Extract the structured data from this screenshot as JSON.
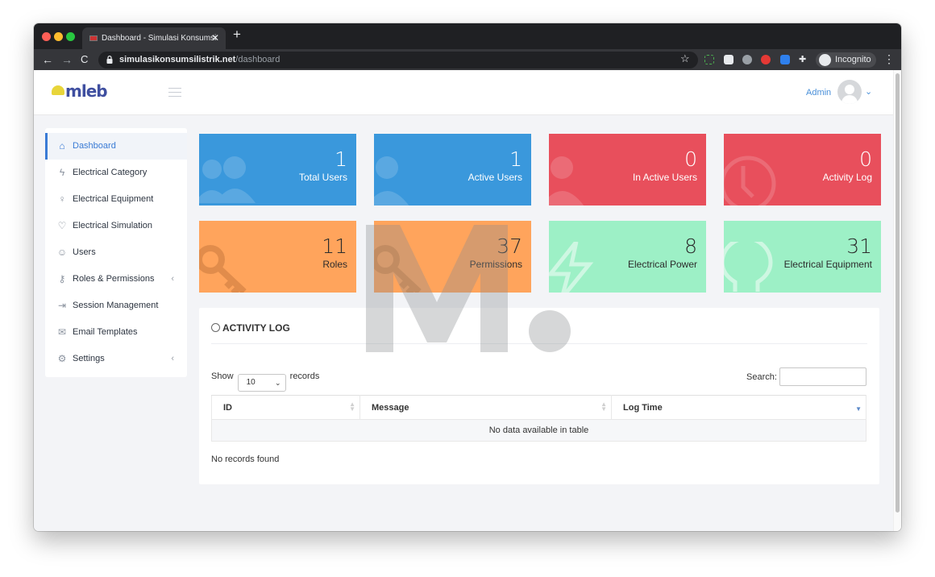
{
  "browser": {
    "tab_title": "Dashboard - Simulasi Konsumsi",
    "url_host": "simulasikonsumsilistrik.net",
    "url_path": "/dashboard",
    "incognito_label": "Incognito"
  },
  "header": {
    "logo_text": "mleb",
    "user_name": "Admin"
  },
  "sidebar": {
    "items": [
      {
        "label": "Dashboard",
        "icon": "home-icon",
        "active": true
      },
      {
        "label": "Electrical Category",
        "icon": "bolt-icon"
      },
      {
        "label": "Electrical Equipment",
        "icon": "lightbulb-icon"
      },
      {
        "label": "Electrical Simulation",
        "icon": "plug-icon"
      },
      {
        "label": "Users",
        "icon": "user-icon"
      },
      {
        "label": "Roles & Permissions",
        "icon": "key-icon",
        "has_submenu": true
      },
      {
        "label": "Session Management",
        "icon": "sign-in-icon"
      },
      {
        "label": "Email Templates",
        "icon": "envelope-icon"
      },
      {
        "label": "Settings",
        "icon": "gear-icon",
        "has_submenu": true
      }
    ]
  },
  "cards": [
    {
      "value": "1",
      "label": "Total Users",
      "color": "#3a98dc",
      "icon": "users-icon"
    },
    {
      "value": "1",
      "label": "Active Users",
      "color": "#3a98dc",
      "icon": "user-icon"
    },
    {
      "value": "0",
      "label": "In Active Users",
      "color": "#e84f5c",
      "icon": "user-icon"
    },
    {
      "value": "0",
      "label": "Activity Log",
      "color": "#e84f5c",
      "icon": "clock-icon"
    },
    {
      "value": "11",
      "label": "Roles",
      "color": "#ffa45c",
      "icon": "key-icon"
    },
    {
      "value": "37",
      "label": "Permissions",
      "color": "#ffa45c",
      "icon": "key-icon"
    },
    {
      "value": "8",
      "label": "Electrical Power",
      "color": "#9df0c6",
      "icon": "bolt-icon"
    },
    {
      "value": "31",
      "label": "Electrical Equipment",
      "color": "#9df0c6",
      "icon": "lightbulb-icon"
    }
  ],
  "activity_log": {
    "title": "ACTIVITY LOG",
    "show_label": "Show",
    "page_length": "10",
    "records_label": "records",
    "search_label": "Search:",
    "columns": [
      "ID",
      "Message",
      "Log Time"
    ],
    "empty_message": "No data available in table",
    "footer_info": "No records found"
  }
}
